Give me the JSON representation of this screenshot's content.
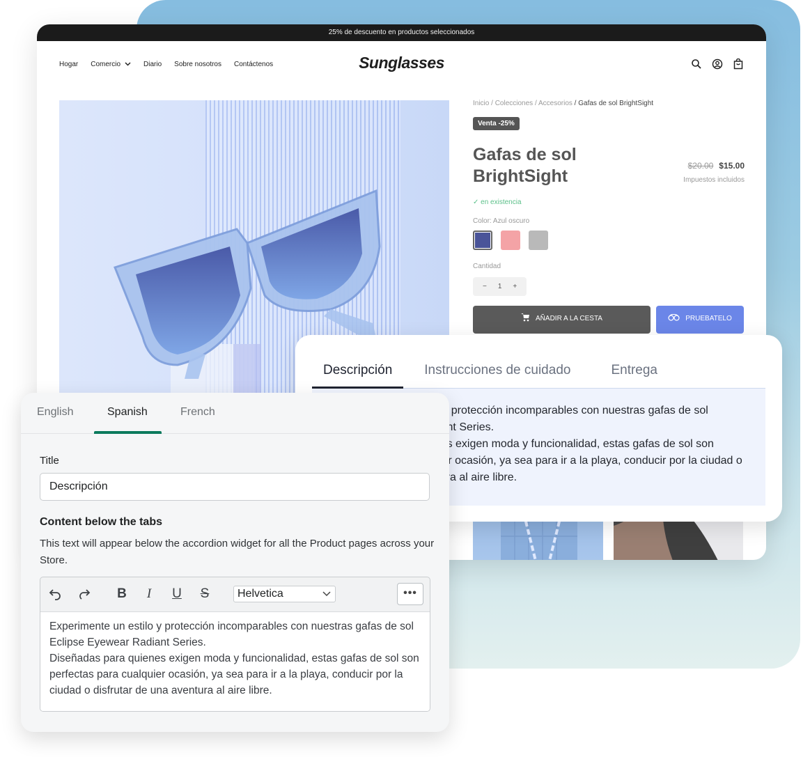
{
  "store": {
    "announcement": "25% de descuento en productos seleccionados",
    "logo": "Sunglasses",
    "nav": [
      {
        "label": "Hogar"
      },
      {
        "label": "Comercio",
        "has_dropdown": true
      },
      {
        "label": "Diario"
      },
      {
        "label": "Sobre nosotros"
      },
      {
        "label": "Contáctenos"
      }
    ],
    "header_icons": [
      "search-icon",
      "account-icon",
      "cart-bag-icon"
    ],
    "breadcrumb": {
      "items": [
        "Inicio",
        "Colecciones",
        "Accesorios"
      ],
      "current": "Gafas de sol BrightSight",
      "separator": " / "
    },
    "sale_badge": "Venta -25%",
    "product_title": "Gafas de sol BrightSight",
    "price_old": "$20.00",
    "price_new": "$15.00",
    "tax_note": "Impuestos incluidos",
    "stock": "✓ en existencia",
    "color_label": "Color: Azul oscuro",
    "swatches": [
      {
        "name": "Azul oscuro",
        "color": "#4a5499",
        "selected": true
      },
      {
        "name": "Rosa",
        "color": "#f4a3a6",
        "selected": false
      },
      {
        "name": "Gris",
        "color": "#b9b9b9",
        "selected": false
      }
    ],
    "quantity_label": "Cantidad",
    "quantity": "1",
    "qty_minus": "−",
    "qty_plus": "+",
    "add_to_cart": "AÑADIR A LA CESTA",
    "try_on": "PRUEBATELO",
    "colors": {
      "accent": "#6b86e8",
      "cart_button": "#5a5a5a",
      "stock": "#5cc08a"
    }
  },
  "description_card": {
    "tabs": [
      {
        "label": "Descripción",
        "active": true
      },
      {
        "label": "Instrucciones de cuidado",
        "active": false
      },
      {
        "label": "Entrega",
        "active": false
      }
    ],
    "body_line1": "Experimente un estilo y protección incomparables con nuestras gafas de sol Eclipse Eyewear Radiant Series.",
    "body_line2": "Diseñadas para quienes exigen moda y funcionalidad, estas gafas de sol son perfectas para cualquier ocasión, ya sea para ir a la playa, conducir por la ciudad o disfrutar de una aventura al aire libre."
  },
  "editor": {
    "language_tabs": [
      {
        "label": "English",
        "active": false
      },
      {
        "label": "Spanish",
        "active": true
      },
      {
        "label": "French",
        "active": false
      }
    ],
    "title_label": "Title",
    "title_value": "Descripción",
    "section_title": "Content below the tabs",
    "help_text": "This text will appear below the accordion widget for all the Product pages across your Store.",
    "toolbar": {
      "undo": "↶",
      "redo": "↷",
      "bold": "B",
      "italic": "I",
      "underline": "U",
      "strikethrough": "S",
      "font": "Helvetica",
      "more": "•••"
    },
    "content_line1": "Experimente un estilo y protección incomparables con nuestras gafas de sol Eclipse Eyewear Radiant Series.",
    "content_line2": "Diseñadas para quienes exigen moda y funcionalidad, estas gafas de sol son perfectas para cualquier ocasión, ya sea para ir a la playa, conducir por la ciudad o disfrutar de una aventura al aire libre.",
    "accent": "#0b7a5c"
  }
}
